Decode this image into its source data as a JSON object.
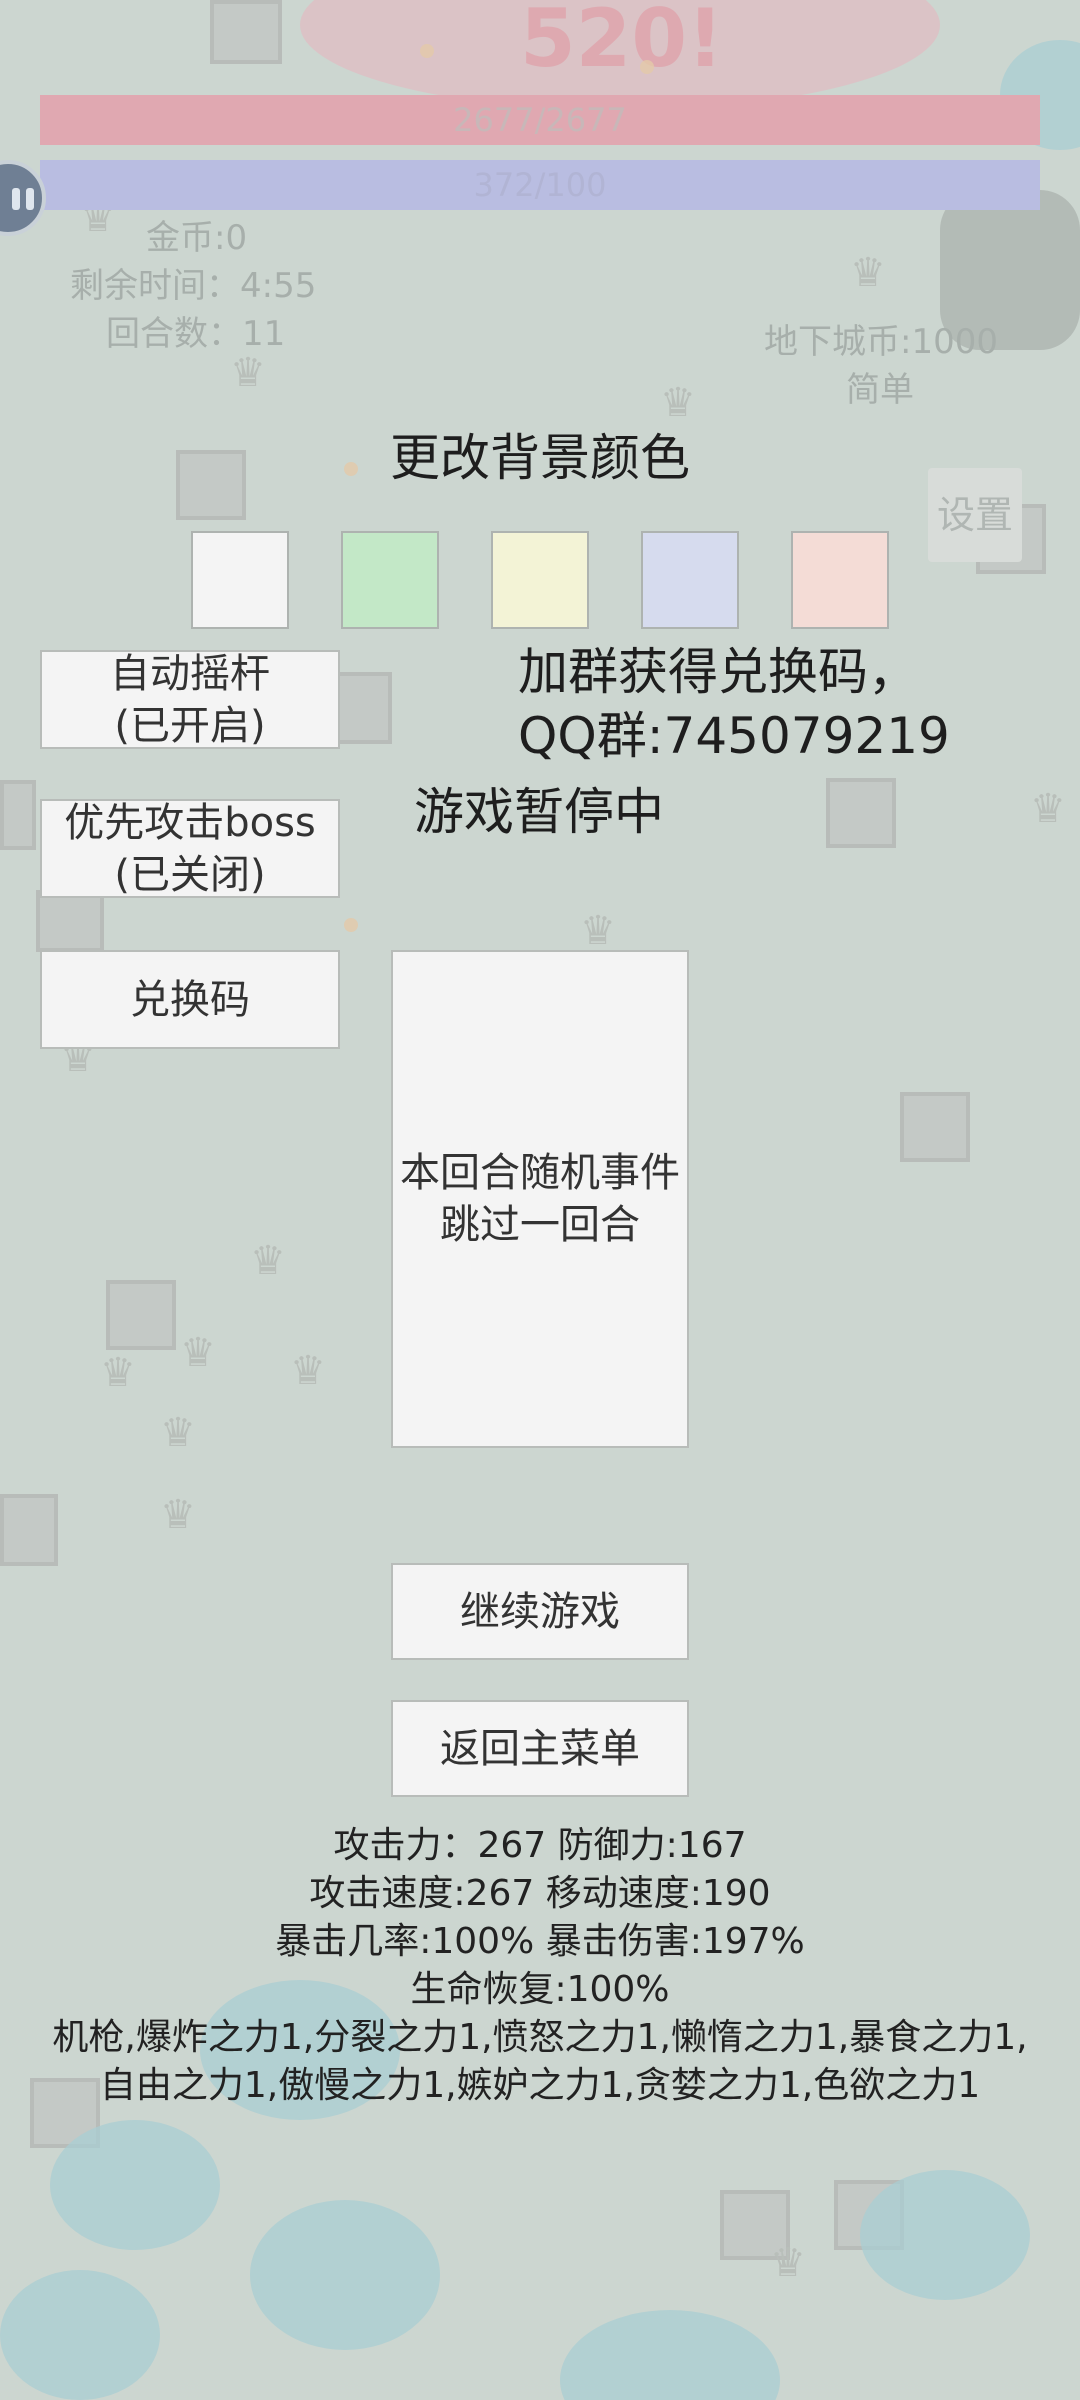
{
  "hud": {
    "hp_text": "2677/2677",
    "mp_text": "372/100",
    "gold": "金币:0",
    "time_left": "剩余时间：4:55",
    "round": "回合数：11",
    "dungeon_coins": "地下城币:1000",
    "difficulty": "简单",
    "settings_label": "设置",
    "damage_popup": "520!"
  },
  "pause_menu": {
    "title": "更改背景颜色",
    "swatches": [
      {
        "name": "white",
        "color": "#f4f4f4"
      },
      {
        "name": "green",
        "color": "#c3e8c7"
      },
      {
        "name": "yellow",
        "color": "#f3f3d6"
      },
      {
        "name": "blue",
        "color": "#d6dbee"
      },
      {
        "name": "pink",
        "color": "#f4dcd6"
      }
    ],
    "auto_joystick": "自动摇杆\n(已开启)",
    "boss_priority": "优先攻击boss\n(已关闭)",
    "redeem_code": "兑换码",
    "notice_line1": "加群获得兑换码，",
    "notice_line2": "QQ群:745079219",
    "paused_text": "游戏暂停中",
    "random_event": "本回合随机事件\n跳过一回合",
    "continue": "继续游戏",
    "main_menu": "返回主菜单"
  },
  "stats": {
    "line1": "攻击力：267 防御力:167",
    "line2": "攻击速度:267 移动速度:190",
    "line3": "暴击几率:100% 暴击伤害:197%",
    "line4": "生命恢复:100%",
    "items": "机枪,爆炸之力1,分裂之力1,愤怒之力1,懒惰之力1,暴食之力1,自由之力1,傲慢之力1,嫉妒之力1,贪婪之力1,色欲之力1"
  }
}
